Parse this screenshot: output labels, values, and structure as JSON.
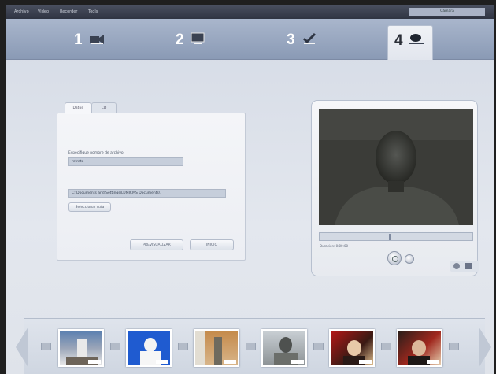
{
  "menubar": {
    "items": [
      "Archivo",
      "Video",
      "Recorder",
      "Tools"
    ],
    "right_field": "Cámara"
  },
  "steps": [
    {
      "number": "1",
      "icon": "camera-icon"
    },
    {
      "number": "2",
      "icon": "monitor-icon"
    },
    {
      "number": "3",
      "icon": "checkmark-icon"
    },
    {
      "number": "4",
      "icon": "mouse-icon",
      "active": true
    }
  ],
  "form": {
    "tabs": [
      "Datos",
      "CD"
    ],
    "filename_label": "Especifique nombre de archivo",
    "filename_value": "retrato",
    "path_value": "C:\\Documents and Settings\\LUMICMS Documents\\",
    "browse_button": "Seleccionar ruta",
    "preview_button": "PREVISUALIZAR",
    "start_button": "INICIO"
  },
  "video": {
    "time_text": "Duración: 0:00:00"
  },
  "colors": {
    "stepbar": "#8a9ab5",
    "panel": "#eceef3",
    "accent": "#3a4556"
  }
}
